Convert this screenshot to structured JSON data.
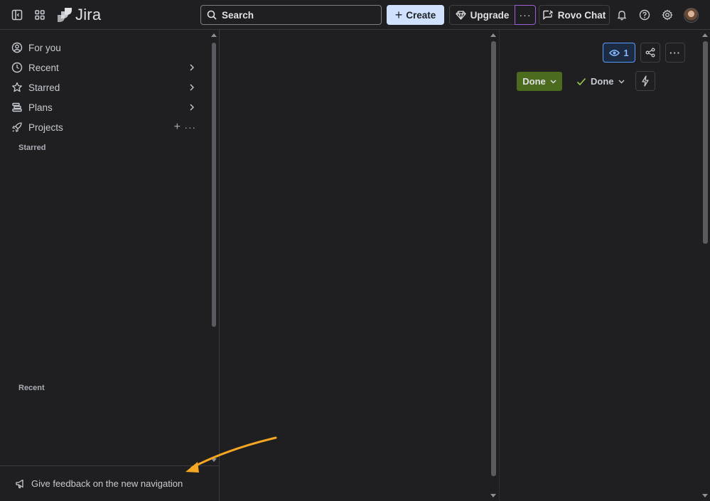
{
  "topbar": {
    "app_name": "Jira",
    "search_placeholder": "Search",
    "create_label": "Create",
    "upgrade_label": "Upgrade",
    "more_label": "···",
    "rovo_label": "Rovo Chat"
  },
  "sidebar": {
    "items": [
      {
        "label": "For you",
        "icon": "person-circle-icon"
      },
      {
        "label": "Recent",
        "icon": "clock-icon"
      },
      {
        "label": "Starred",
        "icon": "star-icon"
      },
      {
        "label": "Plans",
        "icon": "plans-icon"
      },
      {
        "label": "Projects",
        "icon": "rocket-icon"
      }
    ],
    "starred_section": "Starred",
    "recent_section": "Recent",
    "feedback_label": "Give feedback on the new navigation"
  },
  "issue_panel": {
    "watch_count": "1",
    "status_label": "Done",
    "resolution_label": "Done"
  },
  "colors": {
    "background": "#1f1f21",
    "accent_blue": "#579dff",
    "status_green": "#4c6b1f",
    "annotation_arrow": "#f5a623"
  }
}
